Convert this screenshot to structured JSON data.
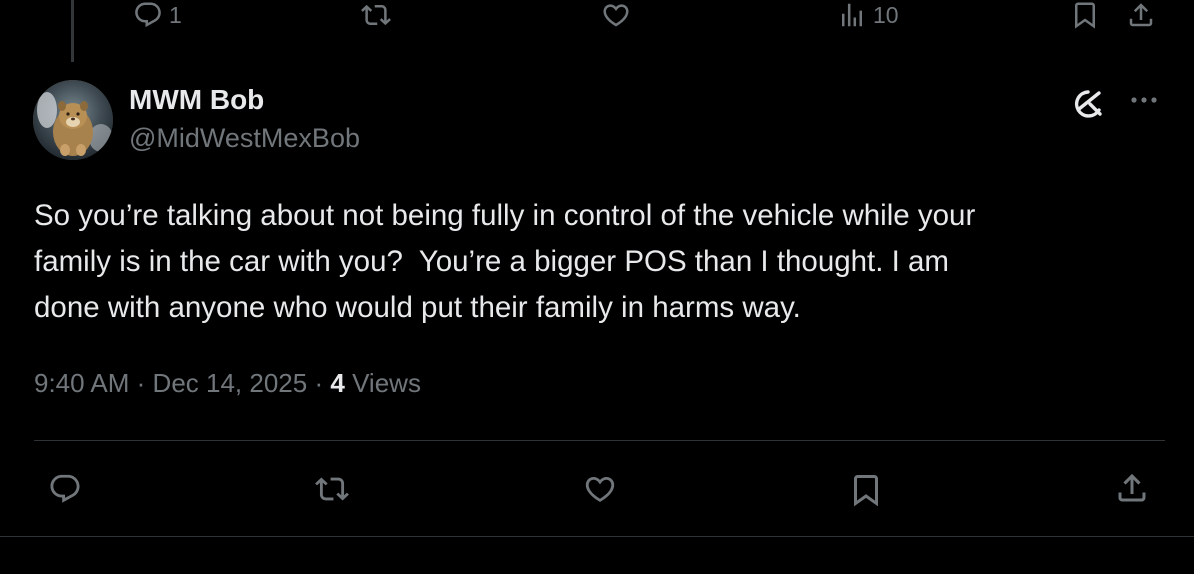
{
  "previous_tweet": {
    "reply_count": "1",
    "views_count": "10"
  },
  "tweet": {
    "author": {
      "display_name": "MWM Bob",
      "handle": "@MidWestMexBob"
    },
    "text": "So you’re talking about not being fully in control of the vehicle while your\nfamily is in the car with you?  You’re a bigger POS than I thought. I am\ndone with anyone who would put their family in harms way.",
    "time": "9:40 AM",
    "separator": "·",
    "date": "Dec 14, 2025",
    "views_count": "4",
    "views_label": "Views"
  },
  "icons": {
    "reply": "reply-icon",
    "repost": "repost-icon",
    "like": "like-icon",
    "views": "views-icon",
    "bookmark": "bookmark-icon",
    "share": "share-icon",
    "grok": "grok-icon",
    "more": "more-icon"
  },
  "colors": {
    "background": "#000000",
    "primary_text": "#e7e9ea",
    "secondary_text": "#71767b",
    "divider": "#2f3336"
  }
}
